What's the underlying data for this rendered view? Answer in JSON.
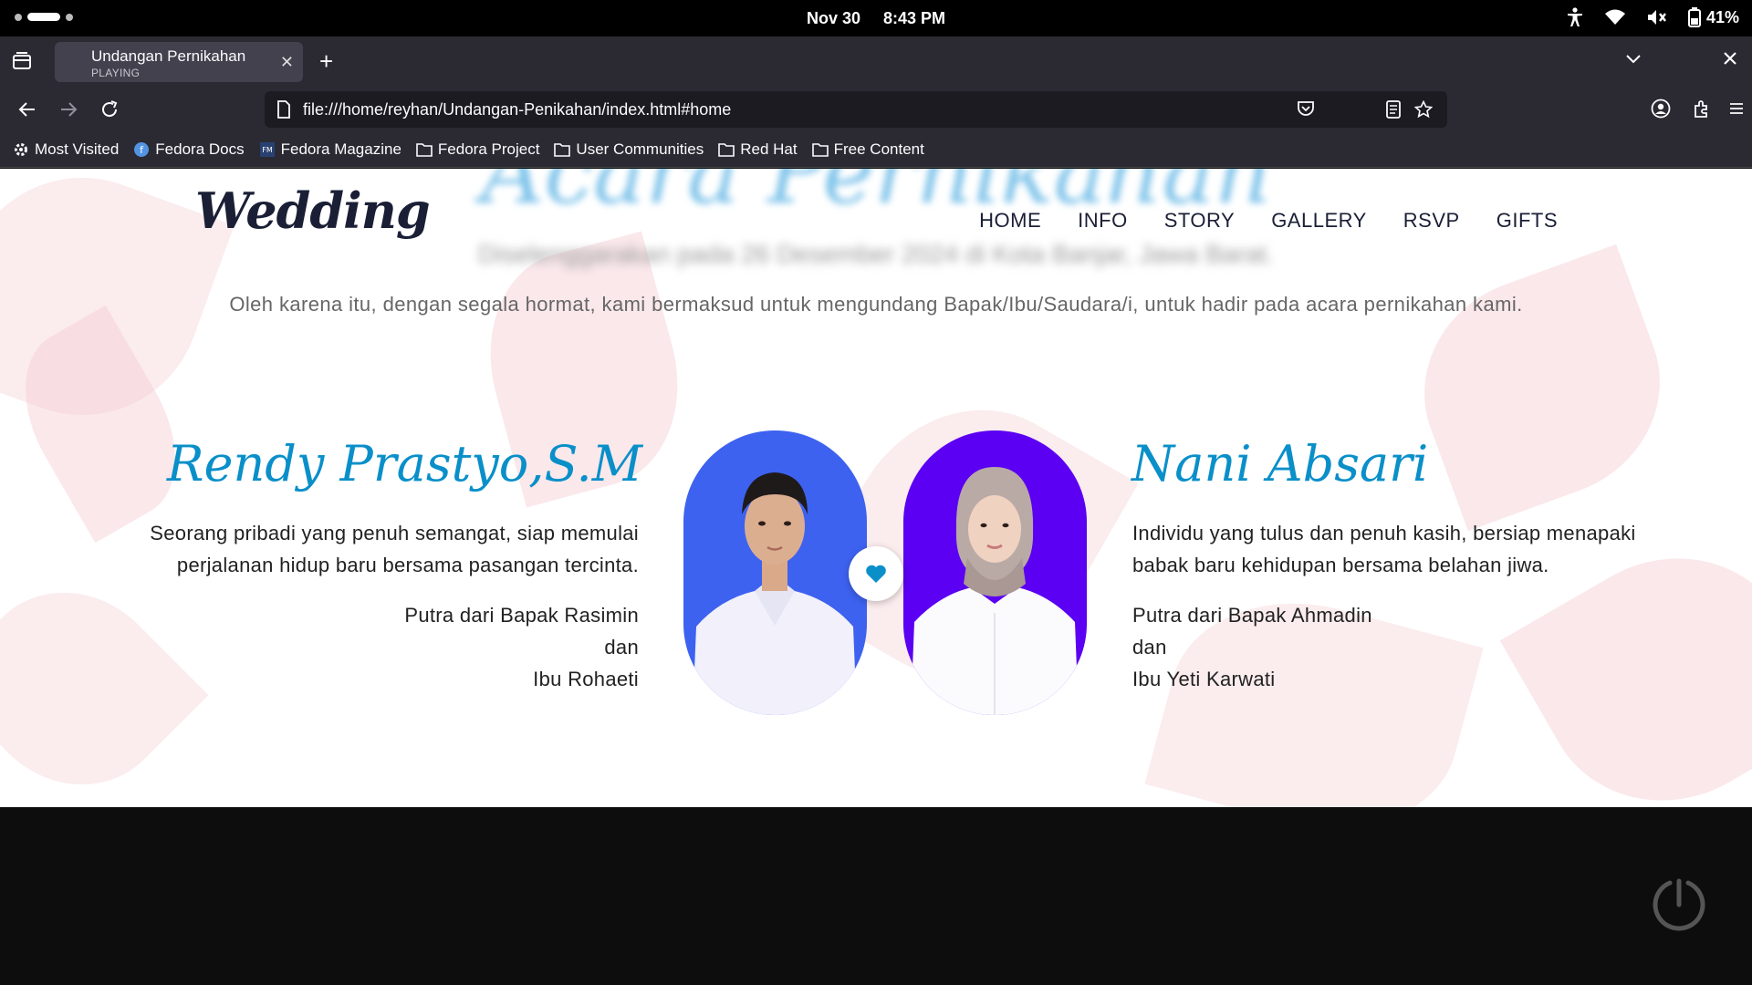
{
  "system": {
    "date": "Nov 30",
    "time": "8:43 PM",
    "battery": "41%"
  },
  "browser": {
    "tab": {
      "title": "Undangan Pernikahan",
      "subtitle": "PLAYING"
    },
    "url": "file:///home/reyhan/Undangan-Penikahan/index.html#home",
    "bookmarks": [
      "Most Visited",
      "Fedora Docs",
      "Fedora Magazine",
      "Fedora Project",
      "User Communities",
      "Red Hat",
      "Free Content"
    ]
  },
  "site": {
    "logo": "Wedding",
    "menu": [
      "HOME",
      "INFO",
      "STORY",
      "GALLERY",
      "RSVP",
      "GIFTS"
    ],
    "faded_title": "Acara Pernikahan",
    "faded_subtitle": "Diselenggarakan pada 26 Desember 2024 di Kota Banjar, Jawa Barat.",
    "intro": "Oleh karena itu, dengan segala hormat, kami bermaksud untuk mengundang Bapak/Ibu/Saudara/i, untuk hadir pada acara pernikahan kami."
  },
  "groom": {
    "name": "Rendy Prastyo,S.M",
    "desc_line1": "Seorang pribadi yang penuh semangat, siap memulai",
    "desc_line2": "perjalanan hidup baru bersama pasangan tercinta.",
    "parent_line1": "Putra dari Bapak Rasimin",
    "parent_line2": "dan",
    "parent_line3": "Ibu Rohaeti"
  },
  "bride": {
    "name": "Nani Absari",
    "desc_line1": "Individu yang tulus dan penuh kasih, bersiap menapaki",
    "desc_line2": "babak baru kehidupan bersama belahan jiwa.",
    "parent_line1": "Putra dari Bapak Ahmadin",
    "parent_line2": "dan",
    "parent_line3": "Ibu Yeti Karwati"
  },
  "colors": {
    "accent": "#0a8fc9",
    "groom_bg": "#3d62f0",
    "bride_bg": "#5b00f2",
    "heart": "#0a8fc9"
  },
  "icons": [
    "workspace-indicator",
    "accessibility-icon",
    "wifi-icon",
    "volume-muted-icon",
    "battery-icon",
    "tab-list-icon",
    "close-icon",
    "new-tab-icon",
    "chevron-down-icon",
    "back-icon",
    "forward-icon",
    "reload-icon",
    "page-icon",
    "reader-view-icon",
    "bookmark-star-icon",
    "pocket-icon",
    "account-icon",
    "extensions-icon",
    "menu-icon",
    "gear-icon",
    "folder-icon",
    "heart-icon",
    "loading-spinner-icon"
  ]
}
